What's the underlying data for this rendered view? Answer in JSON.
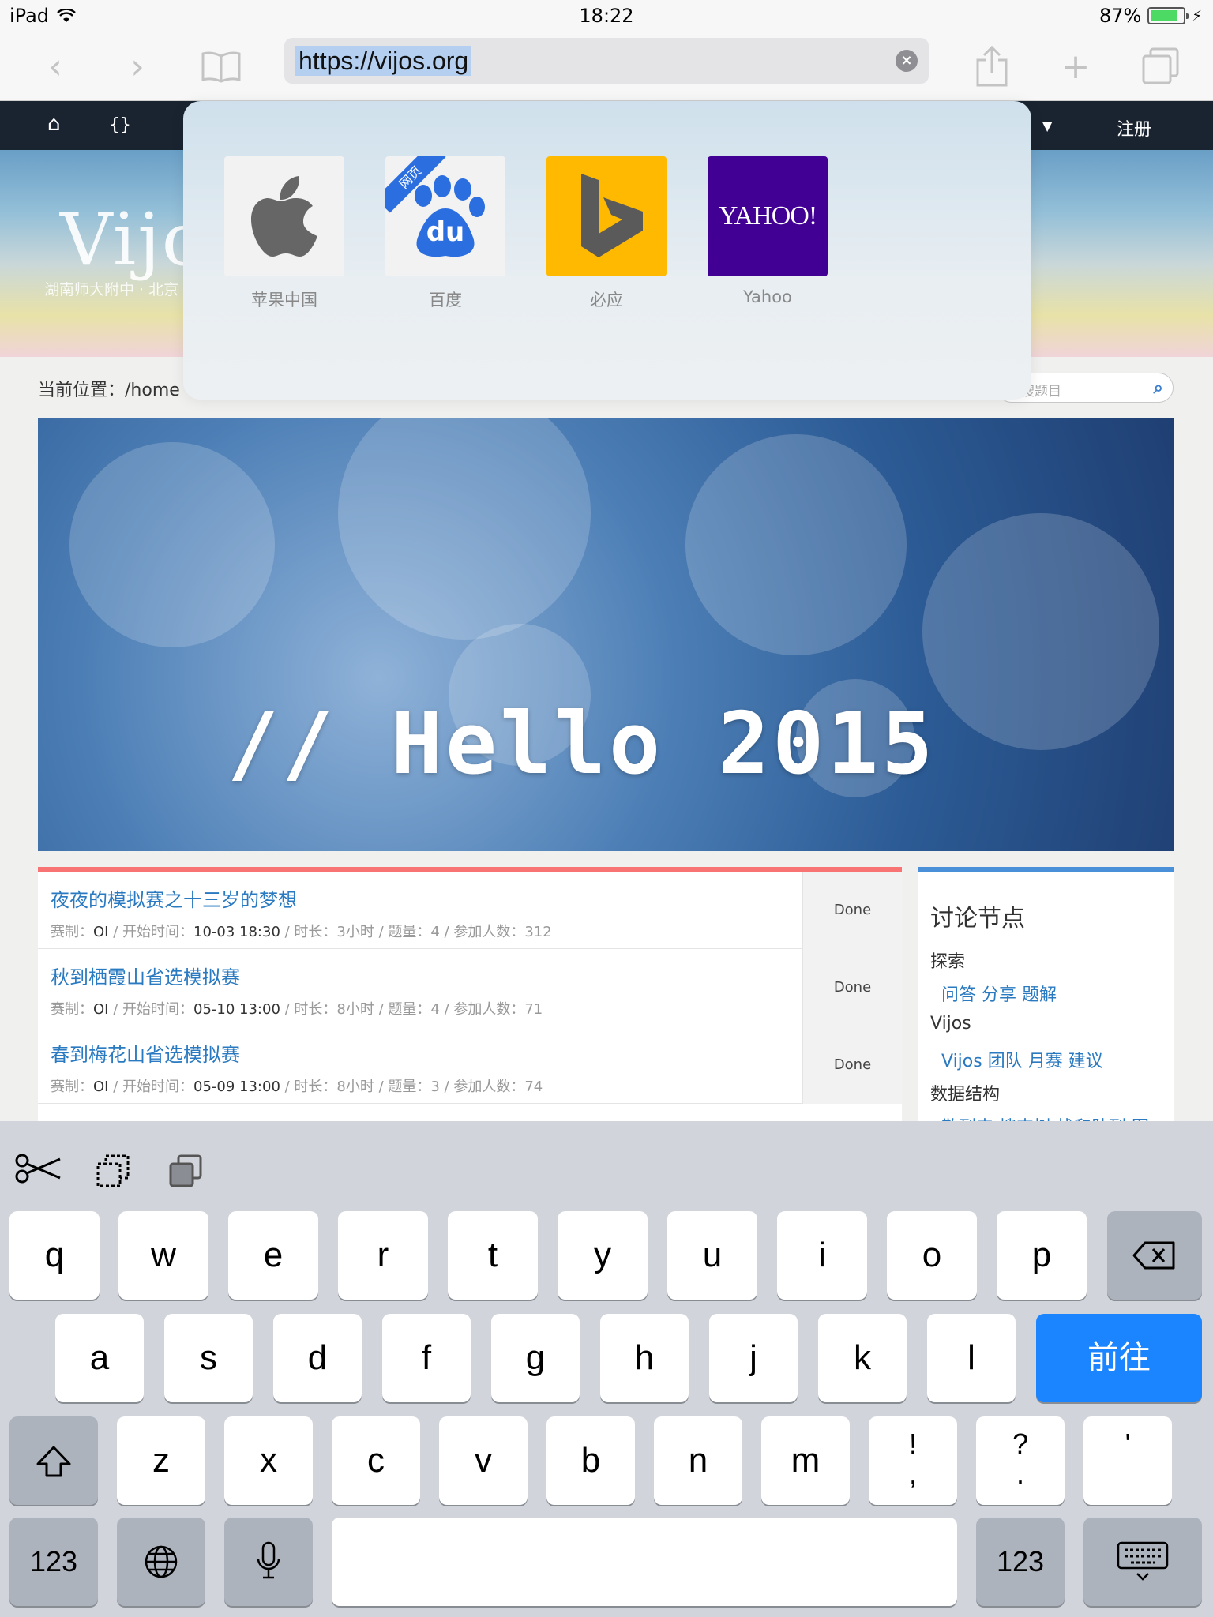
{
  "status": {
    "device": "iPad",
    "time": "18:22",
    "battery": "87%"
  },
  "browser": {
    "url": "https://vijos.org"
  },
  "site": {
    "logo": "Vijos",
    "subtitle": "湖南师大附中 · 北京",
    "register": "注册",
    "breadcrumb": "当前位置：/home",
    "search_placeholder": "搜题目",
    "banner_text": "// Hello 2015",
    "contests": [
      {
        "title": "夜夜的模拟赛之十三岁的梦想",
        "format": "OI",
        "start": "10-03 18:30",
        "duration": "3小时",
        "problems": "4",
        "participants": "312",
        "status": "Done"
      },
      {
        "title": "秋到栖霞山省选模拟赛",
        "format": "OI",
        "start": "05-10 13:00",
        "duration": "8小时",
        "problems": "4",
        "participants": "71",
        "status": "Done"
      },
      {
        "title": "春到梅花山省选模拟赛",
        "format": "OI",
        "start": "05-09 13:00",
        "duration": "8小时",
        "problems": "3",
        "participants": "74",
        "status": "Done"
      }
    ],
    "meta_labels": {
      "format": "赛制：",
      "start": "开始时间：",
      "duration": "时长：",
      "problems": "题量：",
      "participants": "参加人数："
    },
    "discussion": {
      "title": "讨论节点",
      "groups": [
        {
          "name": "探索",
          "links": "问答  分享  题解"
        },
        {
          "name": "Vijos",
          "links": "Vijos  团队  月赛  建议"
        },
        {
          "name": "数据结构",
          "links": "散列表  搜索树  栈和队列  图"
        }
      ]
    }
  },
  "favorites": [
    {
      "label": "苹果中国",
      "icon": "apple-logo-icon",
      "color": "#f2f2f2"
    },
    {
      "label": "百度",
      "icon": "baidu-paw-icon",
      "color": "#f2f2f2",
      "ribbon": "网页",
      "mark": "du"
    },
    {
      "label": "必应",
      "icon": "bing-logo-icon",
      "color": "#ffb900"
    },
    {
      "label": "Yahoo",
      "icon": "yahoo-logo-icon",
      "color": "#410093",
      "mark": "YAHOO!"
    }
  ],
  "keyboard": {
    "row1": [
      "q",
      "w",
      "e",
      "r",
      "t",
      "y",
      "u",
      "i",
      "o",
      "p"
    ],
    "row2": [
      "a",
      "s",
      "d",
      "f",
      "g",
      "h",
      "j",
      "k",
      "l"
    ],
    "row3": [
      "z",
      "x",
      "c",
      "v",
      "b",
      "n",
      "m"
    ],
    "go_label": "前往",
    "numbers_label": "123",
    "punct": [
      {
        "top": "!",
        "bottom": ","
      },
      {
        "top": "?",
        "bottom": "."
      },
      {
        "top": "'",
        "bottom": ""
      }
    ]
  },
  "colors": {
    "accent": "#1b84ff",
    "contest_bar": "#f87373",
    "discussion_bar": "#4a90d9",
    "link": "#2a7ac1"
  }
}
